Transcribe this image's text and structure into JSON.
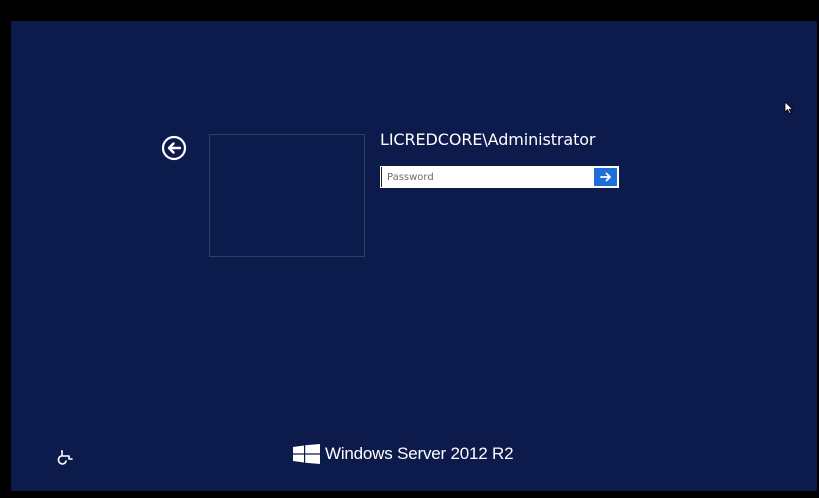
{
  "login": {
    "username": "LICREDCORE\\Administrator",
    "password_placeholder": "Password",
    "password_value": ""
  },
  "branding": {
    "os_name": "Windows Server 2012 R2"
  },
  "icons": {
    "back": "back-arrow-circle-icon",
    "submit": "arrow-right-icon",
    "ease_of_access": "ease-of-access-icon",
    "logo": "windows-logo-icon",
    "cursor": "mouse-pointer-icon"
  },
  "colors": {
    "background": "#0d1b4c",
    "submit_button": "#1e6fd9",
    "text": "#ffffff"
  }
}
